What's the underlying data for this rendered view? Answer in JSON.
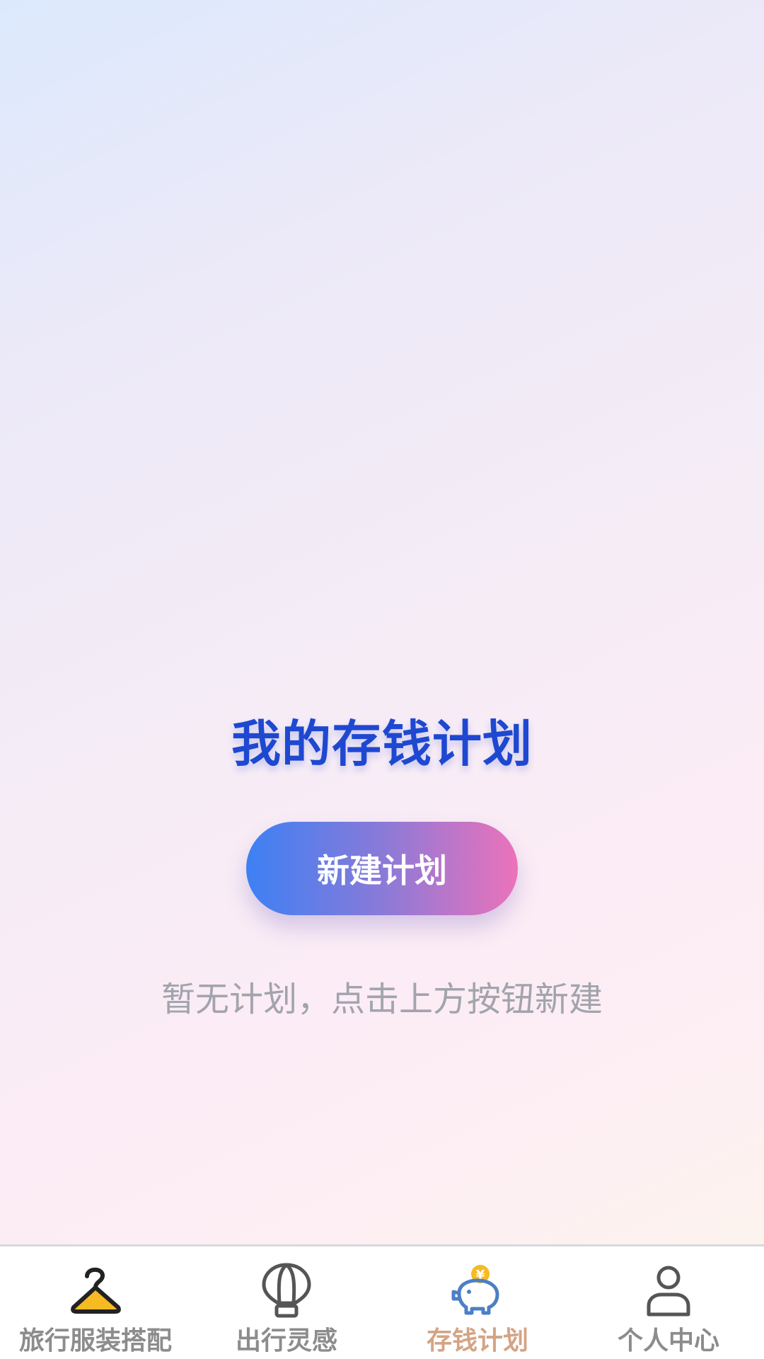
{
  "main": {
    "title": "我的存钱计划",
    "new_plan_button": "新建计划",
    "empty_hint": "暂无计划，点击上方按钮新建"
  },
  "tabbar": {
    "active_index": 2,
    "items": [
      {
        "label": "旅行服装搭配",
        "icon": "hanger-icon"
      },
      {
        "label": "出行灵感",
        "icon": "hot-air-balloon-icon"
      },
      {
        "label": "存钱计划",
        "icon": "piggy-bank-icon"
      },
      {
        "label": "个人中心",
        "icon": "user-icon"
      }
    ]
  },
  "colors": {
    "title": "#1f48d1",
    "button_gradient_start": "#3d80f4",
    "button_gradient_end": "#ec72ba",
    "active_tab_label": "#d4a484",
    "inactive_tab_label": "#8c8c8c",
    "hint_text": "#a2a4ad"
  }
}
